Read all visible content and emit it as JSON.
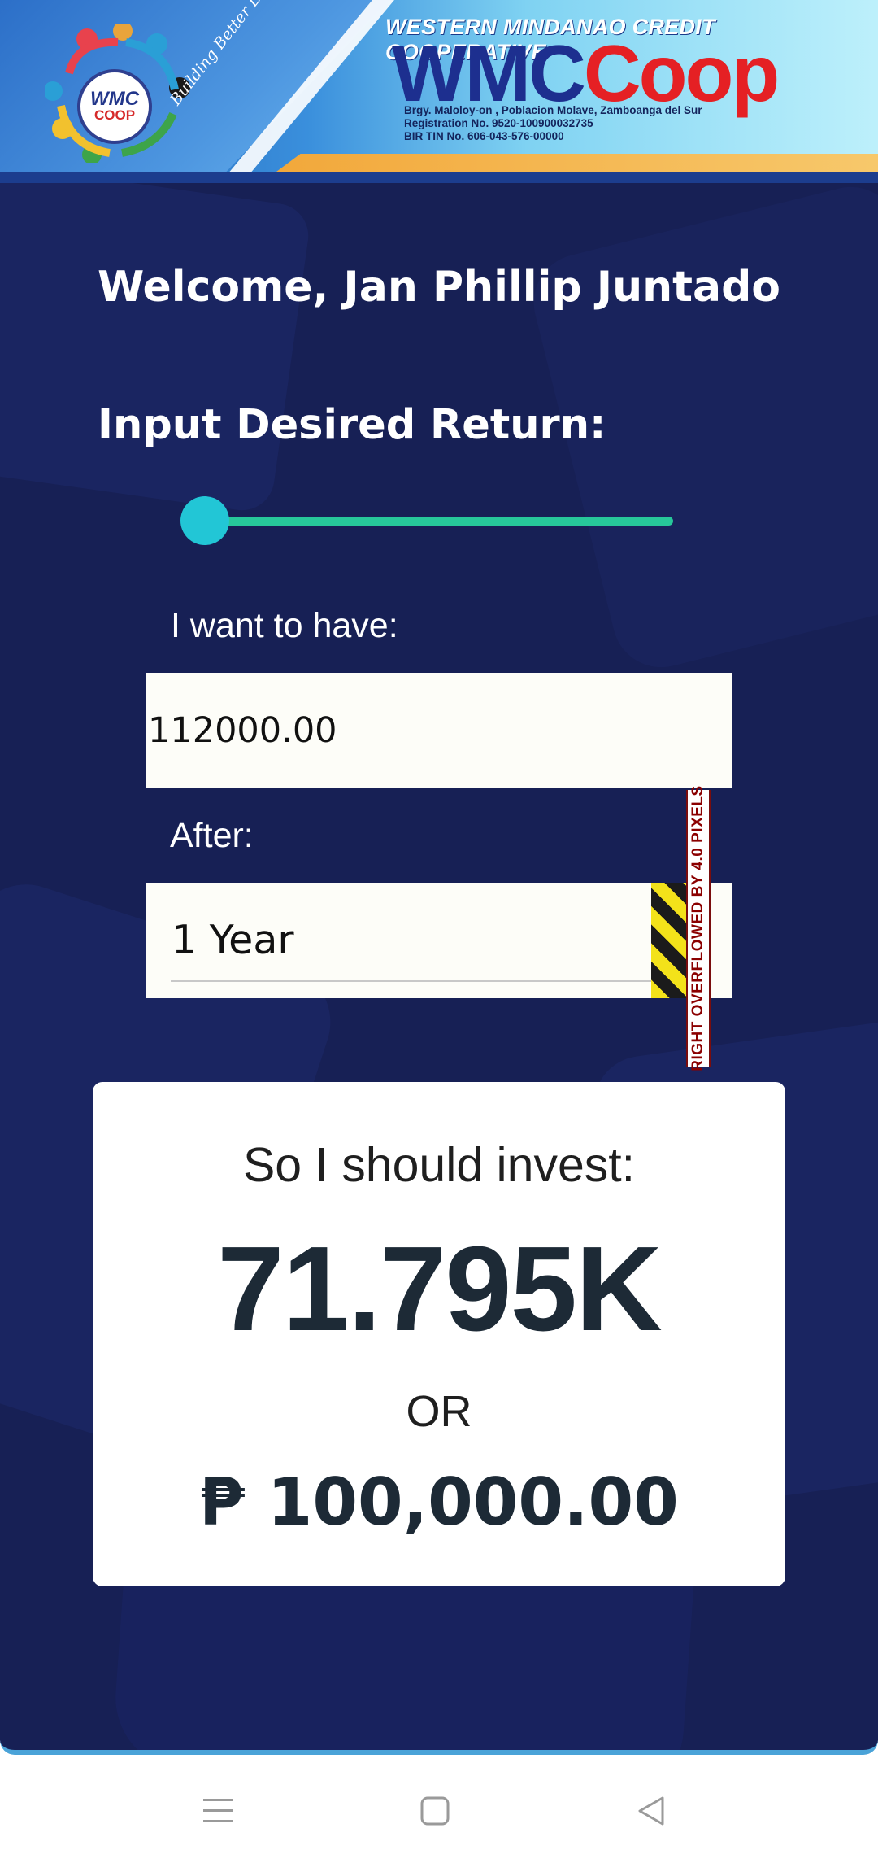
{
  "header": {
    "org_name": "WESTERN MINDANAO CREDIT COOPERATIVE",
    "brand_primary": "WMC",
    "brand_secondary": "Coop",
    "logo_line1": "WMC",
    "logo_line2": "COOP",
    "tagline": "Building Better Lives Together",
    "address": "Brgy. Maloloy-on , Poblacion Molave, Zamboanga del Sur",
    "registration": "Registration No. 9520-100900032735",
    "tin": "BIR TIN No. 606-043-576-00000",
    "colors": {
      "brand_blue": "#1d2f8f",
      "brand_red": "#e52024",
      "accent_orange": "#f2a83b"
    }
  },
  "welcome": "Welcome, Jan Phillip Juntado",
  "form": {
    "title": "Input Desired Return:",
    "slider": {
      "value_fraction": 0.0,
      "track_color": "#27c79a",
      "thumb_color": "#22c6d6"
    },
    "want_label": "I want to have:",
    "want_value": "112000.00",
    "after_label": "After:",
    "after_value": "1 Year",
    "overflow_debug_text": "RIGHT OVERFLOWED BY 4.0 PIXELS"
  },
  "result": {
    "label": "So I should invest:",
    "short_value": "71.795K",
    "or_text": "OR",
    "amount": "₱ 100,000.00"
  },
  "navbar": {
    "icons": [
      "menu-icon",
      "home-square-icon",
      "back-triangle-icon"
    ]
  }
}
